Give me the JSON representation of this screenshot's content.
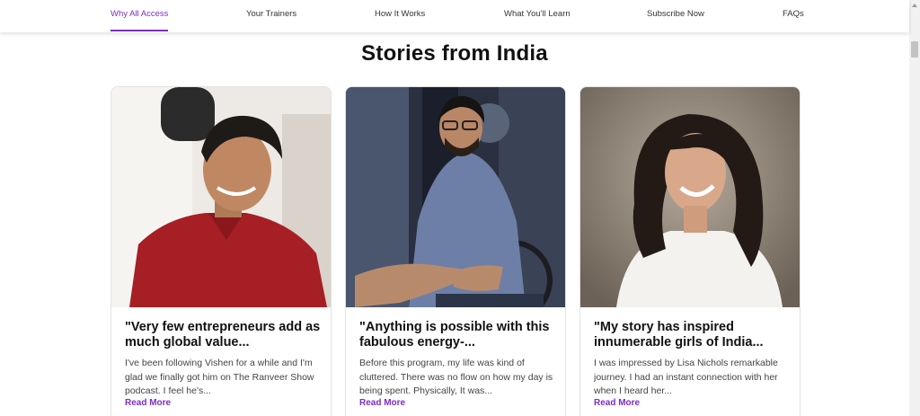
{
  "nav": {
    "items": [
      {
        "label": "Why All Access",
        "active": true
      },
      {
        "label": "Your Trainers",
        "active": false
      },
      {
        "label": "How It Works",
        "active": false
      },
      {
        "label": "What You'll Learn",
        "active": false
      },
      {
        "label": "Subscribe Now",
        "active": false
      },
      {
        "label": "FAQs",
        "active": false
      }
    ]
  },
  "section": {
    "title": "Stories from India"
  },
  "stories": [
    {
      "quote": "\"Very few entrepreneurs add as much global value...",
      "excerpt": "I've been following Vishen for a while and I'm glad we finally got him on The Ranveer Show podcast. I feel he's...",
      "read_more": "Read More",
      "photo": "man-in-red-kurta-photo"
    },
    {
      "quote": "\"Anything is possible with this fabulous energy-...",
      "excerpt": "Before this program, my life was kind of cluttered. There was no flow on how my day is being spent. Physically, It was...",
      "read_more": "Read More",
      "photo": "man-in-wheelchair-photo"
    },
    {
      "quote": "\"My story has inspired innumerable girls of India...",
      "excerpt": "I was impressed by Lisa Nichols remarkable journey. I had an instant connection with her when I heard her...",
      "read_more": "Read More",
      "photo": "woman-smiling-photo"
    }
  ],
  "colors": {
    "accent": "#7b2ec4",
    "title": "#111111",
    "body_text": "#444444"
  }
}
